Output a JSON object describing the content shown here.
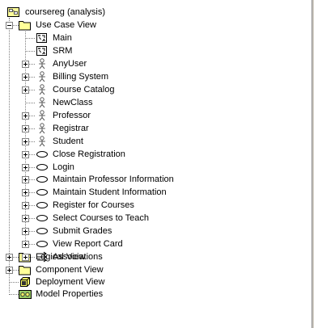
{
  "tree": {
    "root": {
      "label": "coursereg (analysis)",
      "icon": "model-root-icon"
    },
    "use_case_view": {
      "label": "Use Case View",
      "icon": "folder-icon",
      "children": [
        {
          "label": "Main",
          "icon": "diagram-icon",
          "expandable": false
        },
        {
          "label": "SRM",
          "icon": "diagram-icon",
          "expandable": false
        },
        {
          "label": "AnyUser",
          "icon": "actor-icon",
          "expandable": true
        },
        {
          "label": "Billing System",
          "icon": "actor-icon",
          "expandable": true
        },
        {
          "label": "Course Catalog",
          "icon": "actor-icon",
          "expandable": true
        },
        {
          "label": "NewClass",
          "icon": "actor-icon",
          "expandable": false
        },
        {
          "label": "Professor",
          "icon": "actor-icon",
          "expandable": true
        },
        {
          "label": "Registrar",
          "icon": "actor-icon",
          "expandable": true
        },
        {
          "label": "Student",
          "icon": "actor-icon",
          "expandable": true
        },
        {
          "label": "Close Registration",
          "icon": "use-case-icon",
          "expandable": true
        },
        {
          "label": "Login",
          "icon": "use-case-icon",
          "expandable": true
        },
        {
          "label": "Maintain Professor Information",
          "icon": "use-case-icon",
          "expandable": true
        },
        {
          "label": "Maintain Student Information",
          "icon": "use-case-icon",
          "expandable": true
        },
        {
          "label": "Register for Courses",
          "icon": "use-case-icon",
          "expandable": true
        },
        {
          "label": "Select Courses to Teach",
          "icon": "use-case-icon",
          "expandable": true
        },
        {
          "label": "Submit Grades",
          "icon": "use-case-icon",
          "expandable": true
        },
        {
          "label": "View Report Card",
          "icon": "use-case-icon",
          "expandable": true
        },
        {
          "label": "Associations",
          "icon": "associations-icon",
          "expandable": true
        }
      ]
    },
    "logical_view": {
      "label": "Logical View",
      "icon": "folder-icon"
    },
    "component_view": {
      "label": "Component View",
      "icon": "folder-icon"
    },
    "deployment_view": {
      "label": "Deployment View",
      "icon": "deployment-icon"
    },
    "model_properties": {
      "label": "Model Properties",
      "icon": "model-properties-icon"
    }
  },
  "colors": {
    "folder_fill": "#ffff99",
    "folder_outline": "#000000",
    "actor_stroke": "#5a5a5a",
    "tree_lines": "#808080"
  }
}
